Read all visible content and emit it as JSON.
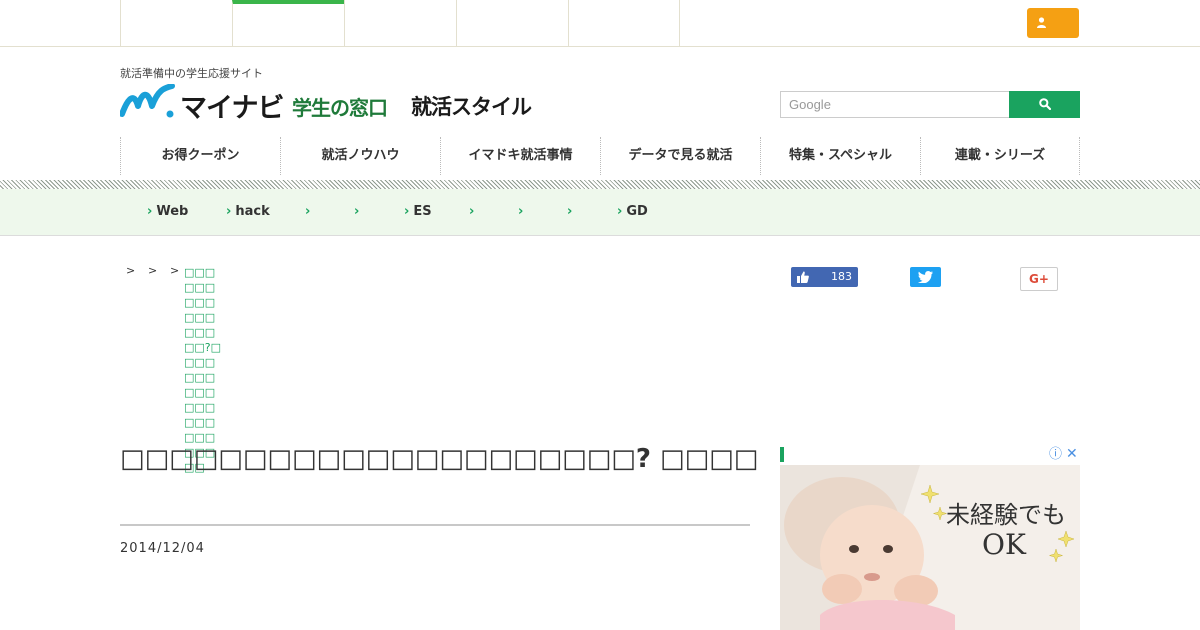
{
  "topbar": {
    "tabs": [
      "",
      "",
      "",
      "",
      ""
    ],
    "active_index": 1,
    "login_icon": "user-icon"
  },
  "header": {
    "tagline": "就活準備中の学生応援サイト",
    "logo": {
      "mynavi": "マイナビ",
      "gakusei": "学生の窓口",
      "style": "就活スタイル"
    },
    "search": {
      "placeholder": "Google",
      "icon": "search-icon"
    }
  },
  "mainnav": {
    "items": [
      "お得クーポン",
      "就活ノウハウ",
      "イマドキ就活事情",
      "データで見る就活",
      "特集・スペシャル",
      "連載・シリーズ"
    ]
  },
  "subnav": {
    "items": [
      "Web",
      "hack",
      "",
      "",
      "ES",
      "",
      "",
      "",
      "GD"
    ]
  },
  "breadcrumb": {
    "separators": [
      ">",
      ">",
      ">"
    ],
    "current": "□□□□□□□□□□□□□□□□□?□□□□□□□□□□□□□□□□□□□□□□□□"
  },
  "social": {
    "like_count": "183",
    "gplus_label": "G+"
  },
  "article": {
    "title": "□□□□□□□□□□□□□□□□□□□□□? □□□□□□□□□□□□□□□□□□□□□□□□□□□",
    "date": "2014/12/04"
  },
  "ad": {
    "info_icon": "ⓘ",
    "close_icon": "✕",
    "text_line1": "未経験でも",
    "text_line2": "OK"
  },
  "colors": {
    "brand_green": "#1aa35f",
    "accent_orange": "#f5a013",
    "facebook": "#4267b2",
    "twitter": "#1da1f2",
    "gplus": "#dd4b39"
  }
}
